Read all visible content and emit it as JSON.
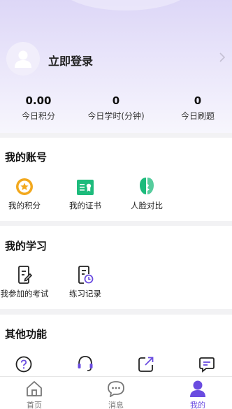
{
  "profile": {
    "login_label": "立即登录"
  },
  "stats": [
    {
      "value": "0.00",
      "label": "今日积分"
    },
    {
      "value": "0",
      "label": "今日学时(分钟)"
    },
    {
      "value": "0",
      "label": "今日刷题"
    }
  ],
  "account": {
    "title": "我的账号",
    "items": [
      {
        "label": "我的积分",
        "icon": "points-coin-icon"
      },
      {
        "label": "我的证书",
        "icon": "certificate-icon"
      },
      {
        "label": "人脸对比",
        "icon": "face-compare-icon"
      }
    ]
  },
  "study": {
    "title": "我的学习",
    "items": [
      {
        "label": "我参加的考试",
        "icon": "exam-icon"
      },
      {
        "label": "练习记录",
        "icon": "practice-record-icon"
      }
    ]
  },
  "other": {
    "title": "其他功能",
    "items": [
      {
        "icon": "help-icon"
      },
      {
        "icon": "customer-service-icon"
      },
      {
        "icon": "share-icon"
      },
      {
        "icon": "feedback-icon"
      }
    ]
  },
  "tabbar": [
    {
      "label": "首页",
      "icon": "home-icon"
    },
    {
      "label": "消息",
      "icon": "message-icon"
    },
    {
      "label": "我的",
      "icon": "profile-icon",
      "active": true
    }
  ],
  "colors": {
    "accent": "#6a4ce0",
    "gold": "#f2a81d",
    "green": "#1dbb7c"
  }
}
